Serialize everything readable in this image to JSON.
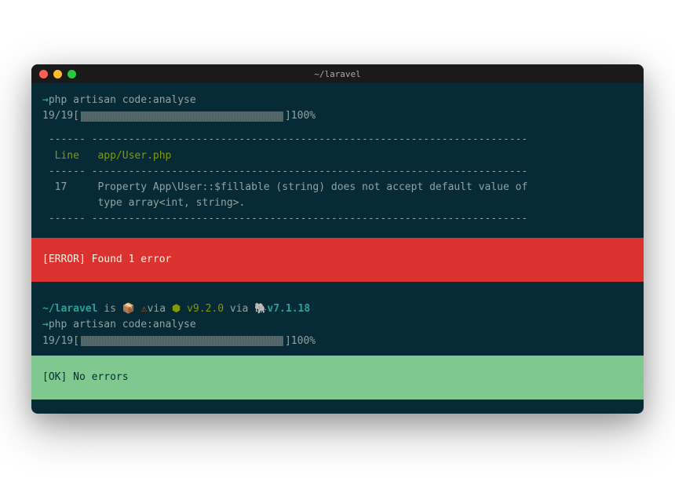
{
  "titlebar": {
    "title": "~/laravel"
  },
  "run1": {
    "prompt_arrow": "→",
    "command": "php artisan code:analyse",
    "progress_count": "19/19",
    "progress_open": "[",
    "progress_close": "]",
    "progress_pct": "100%",
    "dashes1": " ------ ----------------------------------------------------------------------- ",
    "header_line": "  Line   app/User.php",
    "header_col1": "Line",
    "header_col2": "app/User.php",
    "dashes2": " ------ ----------------------------------------------------------------------- ",
    "row1_line": "  17     Property App\\User::$fillable (string) does not accept default value of",
    "row1_num": "17",
    "row1_msg": "Property App\\User::$fillable (string) does not accept default value of",
    "row2_line": "         type array<int, string>.",
    "row2_msg": "type array<int, string>.",
    "dashes3": " ------ ----------------------------------------------------------------------- ",
    "error_label": "[ERROR] Found 1 error"
  },
  "run2": {
    "prompt_path": "~/laravel",
    "prompt_is": " is ",
    "emoji_pkg": "📦",
    "emoji_warn": "⚠",
    "emoji_node": "⬢",
    "emoji_php": "🐘",
    "via_txt": "via ",
    "node_ver": "v9.2.0 ",
    "php_ver": "v7.1.18",
    "prompt_arrow": "→",
    "command": "php artisan code:analyse",
    "progress_count": "19/19",
    "progress_open": "[",
    "progress_close": "]",
    "progress_pct": "100%",
    "ok_label": "[OK] No errors"
  }
}
